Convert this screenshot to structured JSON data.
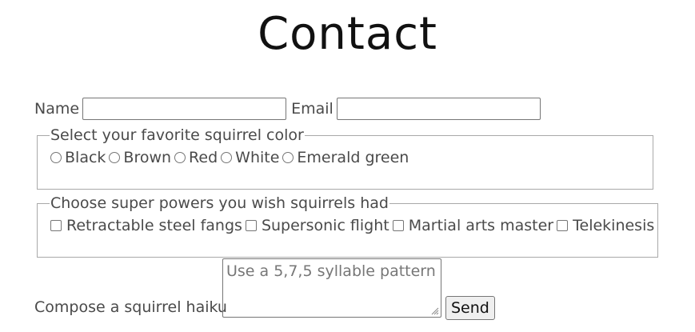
{
  "page": {
    "title": "Contact"
  },
  "form": {
    "name_label": "Name",
    "name_value": "",
    "email_label": "Email",
    "email_value": "",
    "color_group": {
      "legend": "Select your favorite squirrel color",
      "options": [
        "Black",
        "Brown",
        "Red",
        "White",
        "Emerald green"
      ]
    },
    "powers_group": {
      "legend": "Choose super powers you wish squirrels had",
      "options": [
        "Retractable steel fangs",
        "Supersonic flight",
        "Martial arts master",
        "Telekinesis"
      ]
    },
    "haiku_label": "Compose a squirrel haiku",
    "haiku_placeholder": "Use a 5,7,5 syllable pattern",
    "send_label": "Send"
  }
}
